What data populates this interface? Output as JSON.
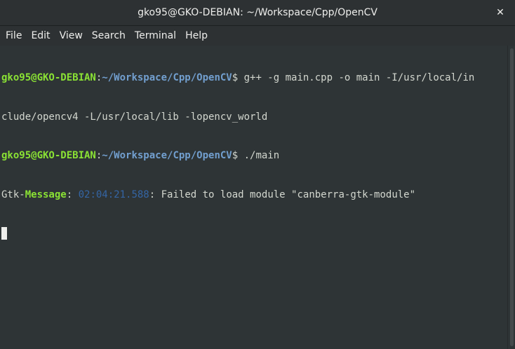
{
  "window": {
    "title": "gko95@GKO-DEBIAN: ~/Workspace/Cpp/OpenCV",
    "close_glyph": "✕"
  },
  "menu": [
    "File",
    "Edit",
    "View",
    "Search",
    "Terminal",
    "Help"
  ],
  "terminal": {
    "line1": {
      "user": "gko95@GKO-DEBIAN",
      "sep": ":",
      "path": "~/Workspace/Cpp/OpenCV",
      "prompt": "$ ",
      "command": "g++ -g main.cpp -o main -I/usr/local/in"
    },
    "line2": {
      "text": "clude/opencv4 -L/usr/local/lib -lopencv_world"
    },
    "line3": {
      "user": "gko95@GKO-DEBIAN",
      "sep": ":",
      "path": "~/Workspace/Cpp/OpenCV",
      "prompt": "$ ",
      "command": "./main"
    },
    "line4": {
      "prefix": "Gtk-",
      "label": "Message",
      "sep1": ": ",
      "timestamp": "02:04:21.588",
      "sep2": ": ",
      "text": "Failed to load module \"canberra-gtk-module\""
    }
  },
  "colors": {
    "background": "#2e3436",
    "user": "#8ae234",
    "path": "#729fcf",
    "timestamp": "#3465a4",
    "text": "#d3d7cf"
  }
}
